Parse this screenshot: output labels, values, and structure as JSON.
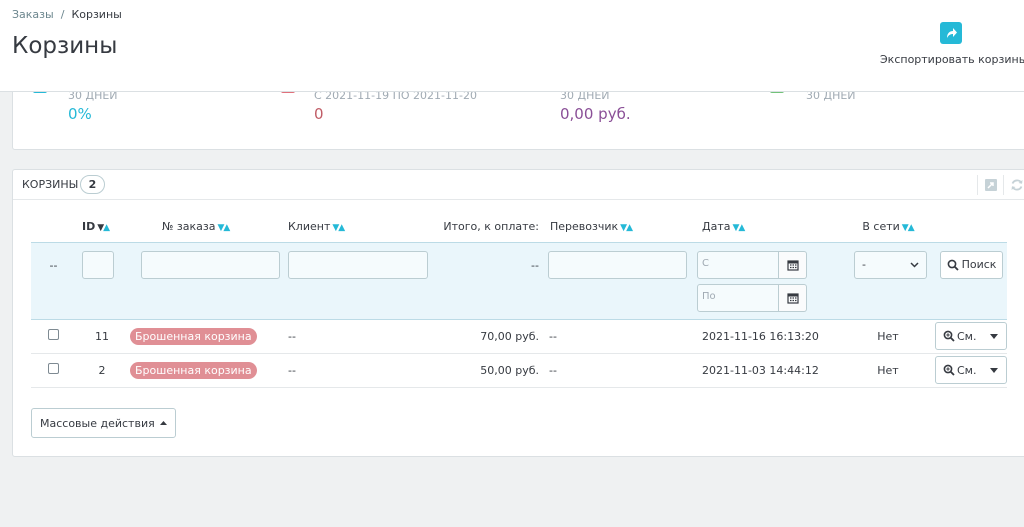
{
  "breadcrumb": {
    "parent": "Заказы",
    "separator": "/",
    "current": "Корзины"
  },
  "page_title": "Корзины",
  "toolbar": {
    "export_label": "Экспортировать корзины"
  },
  "kpis": [
    {
      "subtitle": "30 ДНЕЙ",
      "value": "0%",
      "color": "#25b9d7"
    },
    {
      "subtitle": "С 2021-11-19 ПО 2021-11-20",
      "value": "0",
      "color": "#e0707b"
    },
    {
      "subtitle": "30 ДНЕЙ",
      "value": "0,00 руб.",
      "color": "#8a4f97"
    },
    {
      "subtitle": "30 ДНЕЙ",
      "value": "",
      "color": "#72c279"
    }
  ],
  "list": {
    "title": "Корзины",
    "count": "2",
    "columns": {
      "id": "ID",
      "order": "№ заказа",
      "customer": "Клиент",
      "total": "Итого, к оплате:",
      "carrier": "Перевозчик",
      "date": "Дата",
      "online": "В сети"
    },
    "filters": {
      "id_placeholder": "--",
      "total_placeholder": "--",
      "date_from": "С",
      "date_to": "По",
      "online_value": "-",
      "search_label": "Поиск"
    },
    "rows": [
      {
        "id": "11",
        "status": "Брошенная корзина",
        "customer": "--",
        "total": "70,00 руб.",
        "carrier": "--",
        "date": "2021-11-16 16:13:20",
        "online": "Нет",
        "action": "См."
      },
      {
        "id": "2",
        "status": "Брошенная корзина",
        "customer": "--",
        "total": "50,00 руб.",
        "carrier": "--",
        "date": "2021-11-03 14:44:12",
        "online": "Нет",
        "action": "См."
      }
    ],
    "bulk_label": "Массовые действия"
  },
  "colors": {
    "accent": "#25b9d7",
    "abandoned_badge": "#e08f95"
  }
}
